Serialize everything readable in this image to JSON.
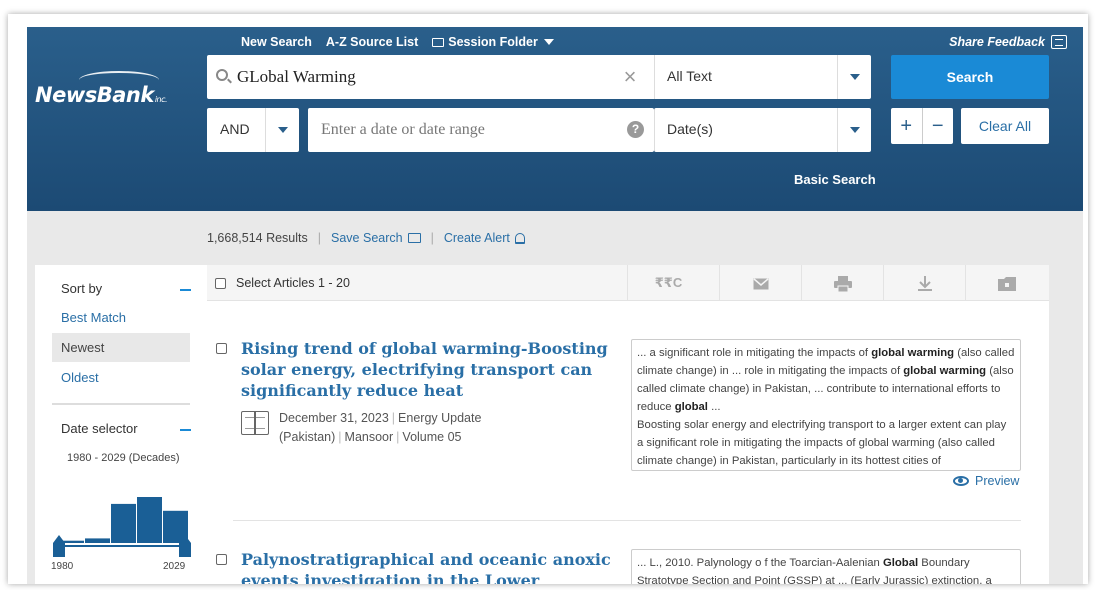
{
  "brand": {
    "logo_text": "NewsBank",
    "logo_suffix": "inc."
  },
  "topnav": {
    "new_search": "New Search",
    "az_source": "A-Z Source List",
    "session_folder": "Session Folder"
  },
  "feedback": "Share Feedback",
  "search": {
    "query": "GLobal Warming",
    "field": "All Text",
    "button": "Search",
    "boolean": "AND",
    "date_placeholder": "Enter a date or date range",
    "date_field": "Date(s)",
    "help": "?",
    "plus": "+",
    "minus": "−",
    "clear_all": "Clear All",
    "basic_search": "Basic Search"
  },
  "results": {
    "count": "1,668,514 Results",
    "save_search": "Save Search",
    "create_alert": "Create Alert"
  },
  "sidebar": {
    "sort_by": "Sort by",
    "options": [
      "Best Match",
      "Newest",
      "Oldest"
    ],
    "active_option": "Newest",
    "date_selector": "Date selector",
    "decades": "1980 - 2029 (Decades)",
    "hist_start": "1980",
    "hist_end": "2029",
    "hist_values": [
      0.05,
      0.1,
      0.85,
      1.0,
      0.7
    ]
  },
  "list": {
    "select_label": "Select Articles 1 - 20",
    "tools": [
      "cite-icon",
      "email-icon",
      "print-icon",
      "download-icon",
      "save-folder-icon"
    ],
    "cite_text": "₹₹C",
    "articles": [
      {
        "title": "Rising trend of global warming-Boosting solar energy, electrifying transport can significantly reduce heat",
        "date": "December 31, 2023",
        "source": "Energy Update (Pakistan)",
        "author": "Mansoor",
        "volume": "Volume 05",
        "snippet_parts": [
          [
            "... a significant role in mitigating the impacts of ",
            false
          ],
          [
            "global warming",
            true
          ],
          [
            " (also called climate change) in ... role in mitigating the impacts of ",
            false
          ],
          [
            "global warming",
            true
          ],
          [
            " (also called climate change) in Pakistan, ... contribute to international efforts to reduce ",
            false
          ],
          [
            "global",
            true
          ],
          [
            " ...",
            false
          ],
          [
            "\nBoosting solar energy and electrifying transport to a larger extent can play a significant role in mitigating the impacts of global warming (also called climate change) in Pakistan, particularly in its hottest cities of",
            false
          ]
        ],
        "preview": "Preview"
      },
      {
        "title": "Palynostratigraphical and oceanic anoxic events investigation in the Lower Jurassic",
        "snippet_parts": [
          [
            "... L., 2010. Palynology o f the Toarcian-Aalenian ",
            false
          ],
          [
            "Global",
            true
          ],
          [
            " Boundary Stratotype Section and Point (GSSP) at ... (Early Jurassic) extinction, a",
            false
          ]
        ]
      }
    ]
  }
}
